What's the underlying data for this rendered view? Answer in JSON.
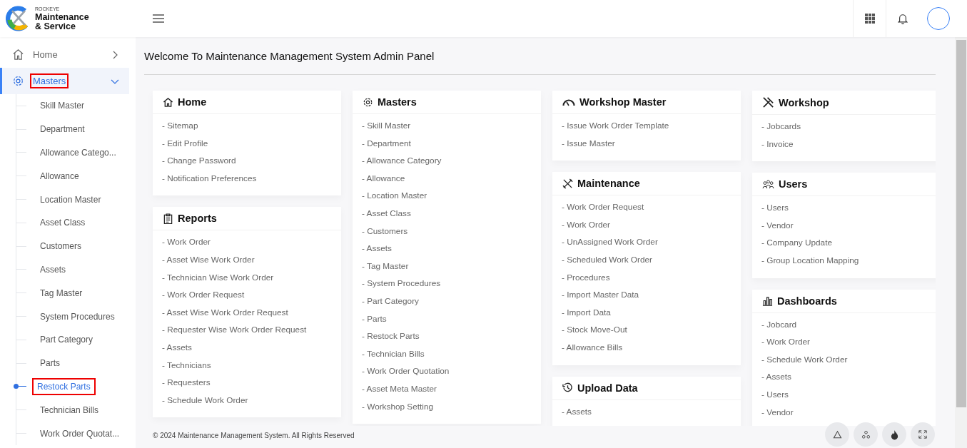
{
  "brand": {
    "tagline": "ROCKEYE",
    "name_line1": "Maintenance",
    "name_line2": "& Service"
  },
  "sidebar": {
    "items": [
      {
        "label": "Home",
        "selected": false,
        "expanded": false,
        "highlighted": false
      },
      {
        "label": "Masters",
        "selected": true,
        "expanded": true,
        "highlighted": true,
        "children": [
          {
            "label": "Skill Master",
            "selected": false,
            "highlighted": false
          },
          {
            "label": "Department",
            "selected": false,
            "highlighted": false
          },
          {
            "label": "Allowance Catego...",
            "selected": false,
            "highlighted": false
          },
          {
            "label": "Allowance",
            "selected": false,
            "highlighted": false
          },
          {
            "label": "Location Master",
            "selected": false,
            "highlighted": false
          },
          {
            "label": "Asset Class",
            "selected": false,
            "highlighted": false
          },
          {
            "label": "Customers",
            "selected": false,
            "highlighted": false
          },
          {
            "label": "Assets",
            "selected": false,
            "highlighted": false
          },
          {
            "label": "Tag Master",
            "selected": false,
            "highlighted": false
          },
          {
            "label": "System Procedures",
            "selected": false,
            "highlighted": false
          },
          {
            "label": "Part Category",
            "selected": false,
            "highlighted": false
          },
          {
            "label": "Parts",
            "selected": false,
            "highlighted": false
          },
          {
            "label": "Restock Parts",
            "selected": true,
            "highlighted": true
          },
          {
            "label": "Technician Bills",
            "selected": false,
            "highlighted": false
          },
          {
            "label": "Work Order Quotat...",
            "selected": false,
            "highlighted": false
          }
        ]
      }
    ]
  },
  "page_title": "Welcome To Maintenance Management System Admin Panel",
  "columns": [
    [
      {
        "title": "Home",
        "links": [
          "- Sitemap",
          "- Edit Profile",
          "- Change Password",
          "- Notification Preferences"
        ]
      },
      {
        "title": "Reports",
        "links": [
          "- Work Order",
          "- Asset Wise Work Order",
          "- Technician Wise Work Order",
          "- Work Order Request",
          "- Asset Wise Work Order Request",
          "- Requester Wise Work Order Request",
          "- Assets",
          "- Technicians",
          "- Requesters",
          "- Schedule Work Order"
        ]
      }
    ],
    [
      {
        "title": "Masters",
        "links": [
          "- Skill Master",
          "- Department",
          "- Allowance Category",
          "- Allowance",
          "- Location Master",
          "- Asset Class",
          "- Customers",
          "- Assets",
          "- Tag Master",
          "- System Procedures",
          "- Part Category",
          "- Parts",
          "- Restock Parts",
          "- Technician Bills",
          "- Work Order Quotation",
          "- Asset Meta Master",
          "- Workshop Setting"
        ]
      }
    ],
    [
      {
        "title": "Workshop Master",
        "links": [
          "- Issue Work Order Template",
          "- Issue Master"
        ]
      },
      {
        "title": "Maintenance",
        "links": [
          "- Work Order Request",
          "- Work Order",
          "- UnAssigned Work Order",
          "- Scheduled Work Order",
          "- Procedures",
          "- Import Master Data",
          "- Import Data",
          "- Stock Move-Out",
          "- Allowance Bills"
        ]
      },
      {
        "title": "Upload Data",
        "links": [
          "- Assets"
        ]
      }
    ],
    [
      {
        "title": "Workshop",
        "links": [
          "- Jobcards",
          "- Invoice"
        ]
      },
      {
        "title": "Users",
        "links": [
          "- Users",
          "- Vendor",
          "- Company Update",
          "- Group Location Mapping"
        ]
      },
      {
        "title": "Dashboards",
        "links": [
          "- Jobcard",
          "- Work Order",
          "- Schedule Work Order",
          "- Assets",
          "- Users",
          "- Vendor"
        ]
      }
    ]
  ],
  "footer": "© 2024 Maintenance Management System. All Rights Reserved"
}
